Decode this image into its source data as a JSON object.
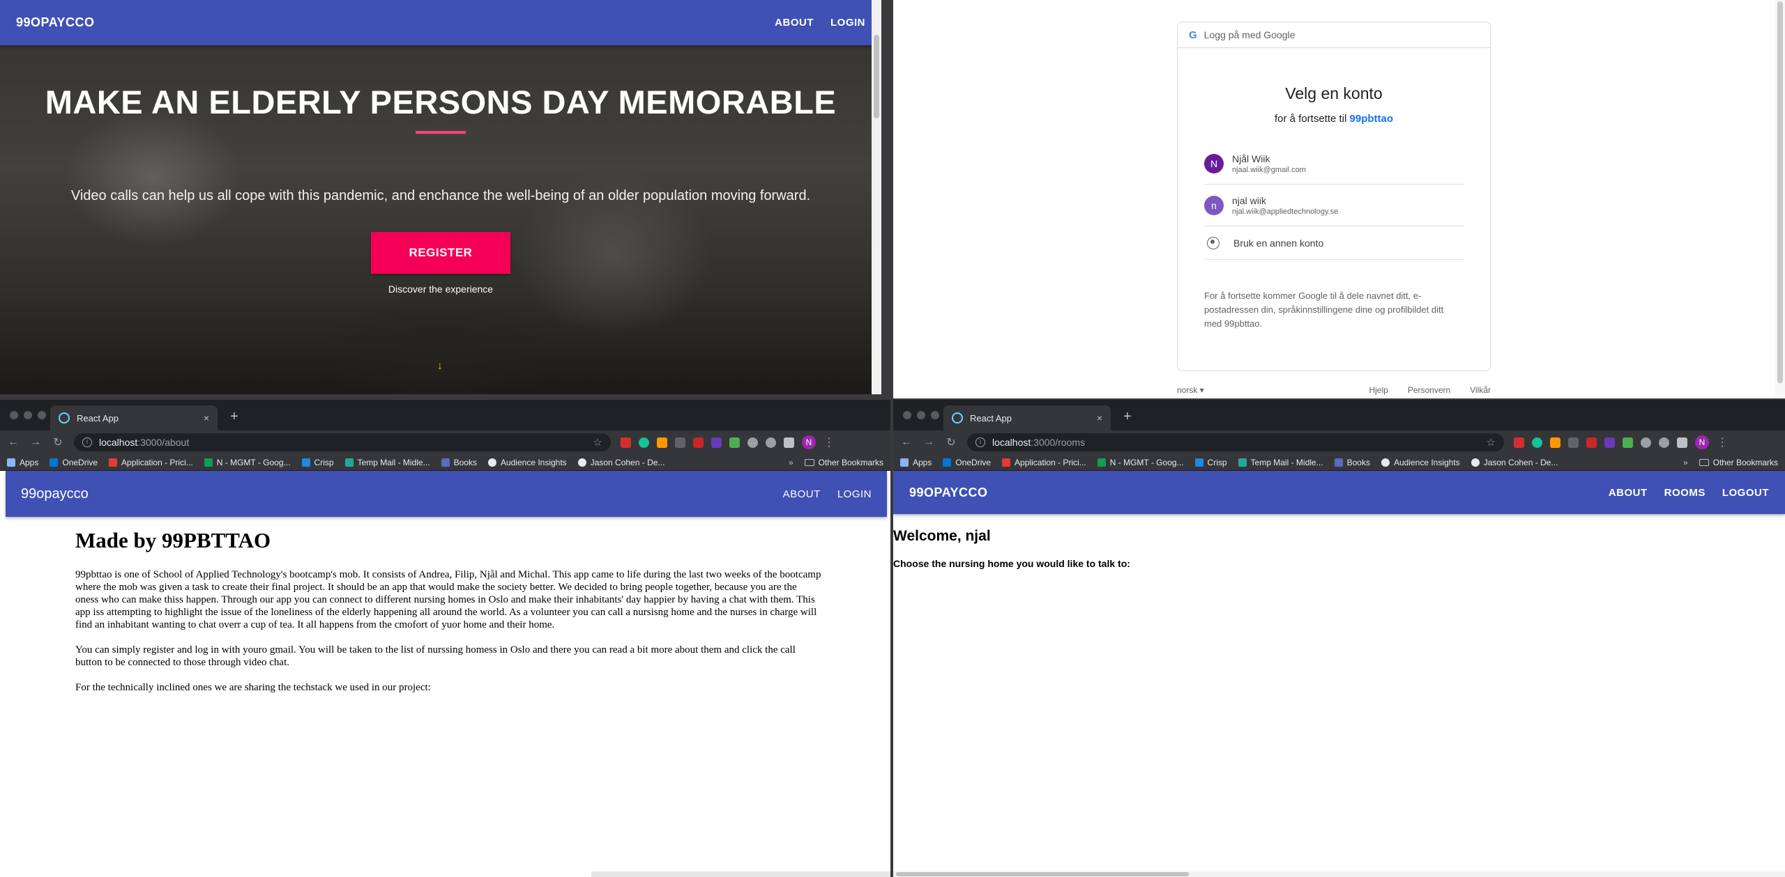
{
  "landing": {
    "brand": "99OPAYCCO",
    "nav": [
      "ABOUT",
      "LOGIN"
    ],
    "title": "MAKE AN ELDERLY PERSONS DAY MEMORABLE",
    "subtitle": "Video calls can help us all cope with this pandemic, and enchance the well-being of an older population moving forward.",
    "cta": "REGISTER",
    "discover": "Discover the experience",
    "arrow": "↓"
  },
  "google": {
    "header": "Logg på med Google",
    "logo": "G",
    "title": "Velg en konto",
    "subtitle_prefix": "for å fortsette til",
    "app_name": "99pbttao",
    "accounts": [
      {
        "initial": "N",
        "name": "Njål Wiik",
        "email": "njaal.wiik@gmail.com",
        "color": "#6a1b9a"
      },
      {
        "initial": "n",
        "name": "njal wiik",
        "email": "njal.wiik@appliedtechnology.se",
        "color": "#7e57c2"
      }
    ],
    "other_account": "Bruk en annen konto",
    "notice": "For å fortsette kommer Google til å dele navnet ditt, e-postadressen din, språkinnstillingene dine og profilbildet ditt med 99pbttao.",
    "language": "norsk ▾",
    "footer_links": [
      "Hjelp",
      "Personvern",
      "Vilkår"
    ]
  },
  "browser": {
    "tab_title": "React App",
    "tab_close": "×",
    "new_tab": "+",
    "back": "←",
    "forward": "→",
    "reload": "↻",
    "star": "☆",
    "kebab": "⋮",
    "avatar": "N",
    "bookmarks": [
      "Apps",
      "OneDrive",
      "Application - Prici...",
      "N - MGMT - Goog...",
      "Crisp",
      "Temp Mail - Midle...",
      "Books",
      "Audience Insights",
      "Jason Cohen - De..."
    ],
    "bookmark_colors": [
      "#8ab4f8",
      "#0078d4",
      "#e53935",
      "#0f9d58",
      "#1e88e5",
      "#26a69a",
      "#5c6bc0",
      "#e8eaed",
      "#e8eaed"
    ],
    "more": "»",
    "other_bookmarks": "Other Bookmarks",
    "ext_colors": [
      "#d32f2f",
      "#15c39a",
      "#ff9800",
      "#5f6368",
      "#c62828",
      "#673ab7",
      "#4caf50",
      "#9aa0a6",
      "#9aa0a6",
      "#bdc1c6"
    ]
  },
  "about_window": {
    "url_host": "localhost",
    "url_path": ":3000/about",
    "brand": "99opaycco",
    "nav": [
      "ABOUT",
      "LOGIN"
    ],
    "heading": "Made by 99PBTTAO",
    "paragraphs": [
      "99pbttao is one of School of Applied Technology's bootcamp's mob. It consists of Andrea, Filip, Njål and Michal. This app came to life during the last two weeks of the bootcamp where the mob was given a task to create their final project. It should be an app that would make the society better. We decided to bring people together, because you are the oness who can make thiss happen. Through our app you can connect to different nursing homes in Oslo and make their inhabitants' day happier by having a chat with them. This app iss attempting to highlight the issue of the loneliness of the elderly happening all around the world. As a volunteer you can call a nursisng home and the nurses in charge will find an inhabitant wanting to chat overr a cup of tea. It all happens from the cmofort of yuor home and their home.",
      "You can simply register and log in with youro gmail. You will be taken to the list of nurssing homess in Oslo and there you can read a bit more about them and click the call button to be connected to those through video chat.",
      "For the technically inclined ones we are sharing the techstack we used in our project:"
    ]
  },
  "rooms_window": {
    "url_host": "localhost",
    "url_path": ":3000/rooms",
    "brand": "99OPAYCCO",
    "nav": [
      "ABOUT",
      "ROOMS",
      "LOGOUT"
    ],
    "welcome": "Welcome, njal",
    "choose": "Choose the nursing home you would like to talk to:"
  }
}
